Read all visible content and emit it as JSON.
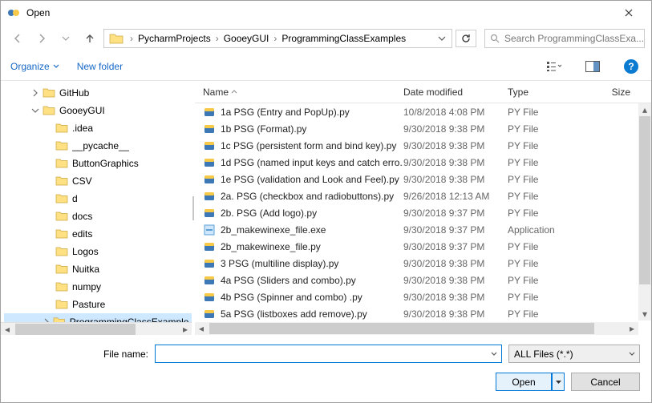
{
  "window": {
    "title": "Open"
  },
  "breadcrumb": {
    "drive_sep": "›",
    "items": [
      "PycharmProjects",
      "GooeyGUI",
      "ProgrammingClassExamples"
    ]
  },
  "search": {
    "placeholder": "Search ProgrammingClassExa..."
  },
  "toolbar": {
    "organize": "Organize",
    "new_folder": "New folder"
  },
  "columns": {
    "name": "Name",
    "date": "Date modified",
    "type": "Type",
    "size": "Size"
  },
  "tree": [
    {
      "label": "GitHub",
      "depth": 2,
      "expand": "closed"
    },
    {
      "label": "GooeyGUI",
      "depth": 2,
      "expand": "open"
    },
    {
      "label": ".idea",
      "depth": 3,
      "expand": "none"
    },
    {
      "label": "__pycache__",
      "depth": 3,
      "expand": "none"
    },
    {
      "label": "ButtonGraphics",
      "depth": 3,
      "expand": "none"
    },
    {
      "label": "CSV",
      "depth": 3,
      "expand": "none"
    },
    {
      "label": "d",
      "depth": 3,
      "expand": "none"
    },
    {
      "label": "docs",
      "depth": 3,
      "expand": "none"
    },
    {
      "label": "edits",
      "depth": 3,
      "expand": "none"
    },
    {
      "label": "Logos",
      "depth": 3,
      "expand": "none"
    },
    {
      "label": "Nuitka",
      "depth": 3,
      "expand": "none"
    },
    {
      "label": "numpy",
      "depth": 3,
      "expand": "none"
    },
    {
      "label": "Pasture",
      "depth": 3,
      "expand": "none"
    },
    {
      "label": "ProgrammingClassExamples",
      "depth": 3,
      "expand": "closed",
      "selected": true
    }
  ],
  "files": [
    {
      "name": "1a PSG (Entry and PopUp).py",
      "date": "10/8/2018 4:08 PM",
      "type": "PY File",
      "icon": "py"
    },
    {
      "name": "1b PSG (Format).py",
      "date": "9/30/2018 9:38 PM",
      "type": "PY File",
      "icon": "py"
    },
    {
      "name": "1c PSG (persistent form and bind key).py",
      "date": "9/30/2018 9:38 PM",
      "type": "PY File",
      "icon": "py"
    },
    {
      "name": "1d PSG (named input keys and catch erro...",
      "date": "9/30/2018 9:38 PM",
      "type": "PY File",
      "icon": "py"
    },
    {
      "name": "1e PSG (validation and Look and Feel).py",
      "date": "9/30/2018 9:38 PM",
      "type": "PY File",
      "icon": "py"
    },
    {
      "name": "2a. PSG (checkbox and radiobuttons).py",
      "date": "9/26/2018 12:13 AM",
      "type": "PY File",
      "icon": "py"
    },
    {
      "name": "2b. PSG (Add logo).py",
      "date": "9/30/2018 9:37 PM",
      "type": "PY File",
      "icon": "py"
    },
    {
      "name": "2b_makewinexe_file.exe",
      "date": "9/30/2018 9:37 PM",
      "type": "Application",
      "icon": "exe"
    },
    {
      "name": "2b_makewinexe_file.py",
      "date": "9/30/2018 9:37 PM",
      "type": "PY File",
      "icon": "py"
    },
    {
      "name": "3 PSG (multiline display).py",
      "date": "9/30/2018 9:38 PM",
      "type": "PY File",
      "icon": "py"
    },
    {
      "name": "4a PSG (Sliders and combo).py",
      "date": "9/30/2018 9:38 PM",
      "type": "PY File",
      "icon": "py"
    },
    {
      "name": "4b PSG (Spinner and combo) .py",
      "date": "9/30/2018 9:38 PM",
      "type": "PY File",
      "icon": "py"
    },
    {
      "name": "5a PSG (listboxes add remove).py",
      "date": "9/30/2018 9:38 PM",
      "type": "PY File",
      "icon": "py"
    }
  ],
  "bottom": {
    "filename_label": "File name:",
    "filter_label": "ALL Files (*.*)",
    "open": "Open",
    "cancel": "Cancel"
  }
}
